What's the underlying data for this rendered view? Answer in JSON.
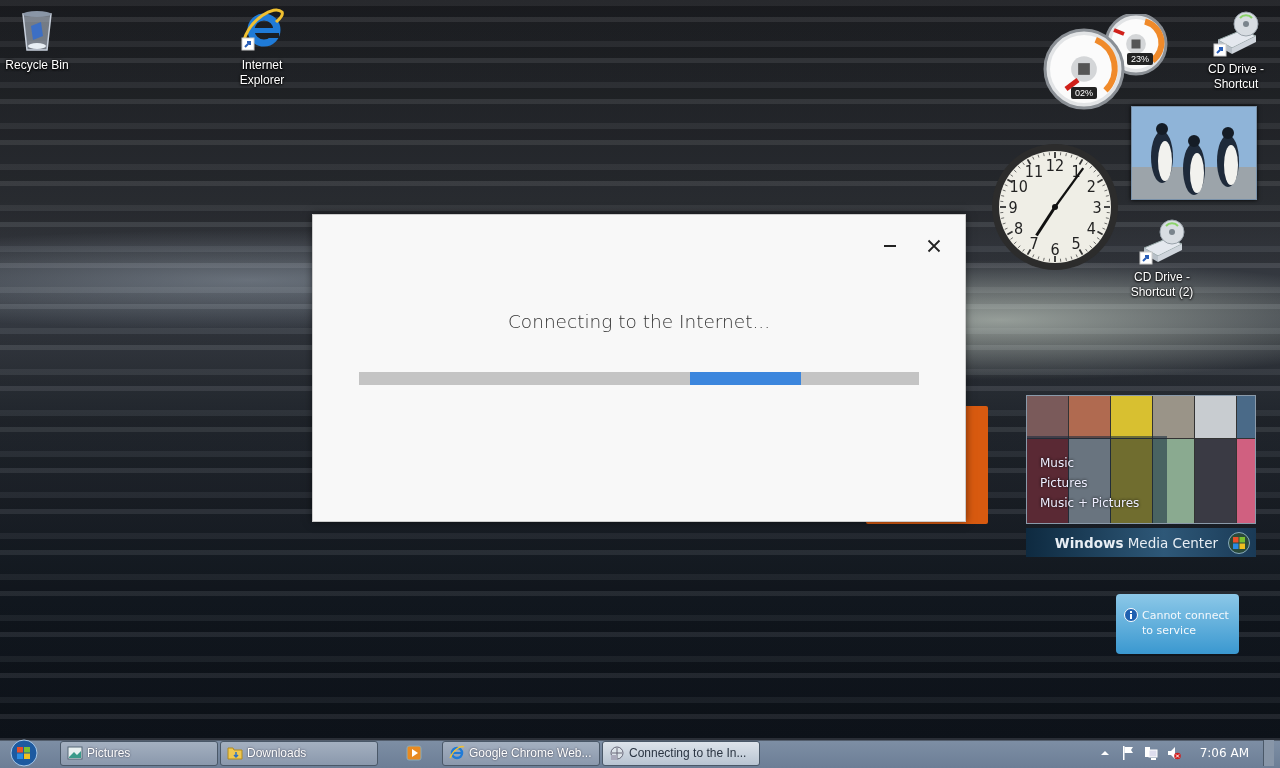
{
  "desktop_icons": [
    {
      "label": "Recycle Bin",
      "kind": "recycle"
    },
    {
      "label": "Internet Explorer",
      "kind": "ie"
    },
    {
      "label": "CD Drive - Shortcut",
      "kind": "cd"
    },
    {
      "label": "CD Drive - Shortcut (2)",
      "kind": "cd"
    }
  ],
  "gadgets": {
    "cpu_meter": {
      "readings": [
        "02%",
        "23%"
      ]
    },
    "clock": {
      "numerals": [
        "12",
        "11",
        "1",
        "10",
        "2",
        "9",
        "3",
        "8",
        "4",
        "7",
        "5",
        "6"
      ]
    },
    "media_center": {
      "menu": [
        "Music",
        "Pictures",
        "Music + Pictures"
      ],
      "brand": "**Windows** Media Center"
    },
    "feed": {
      "message": "Cannot connect to service"
    }
  },
  "dialog": {
    "message": "Connecting to the Internet..."
  },
  "taskbar": {
    "buttons": [
      {
        "label": "Pictures",
        "kind": "pictures",
        "selected": false
      },
      {
        "label": "Downloads",
        "kind": "folder",
        "selected": false
      },
      {
        "kind": "media",
        "selected": false
      },
      {
        "label": "Google Chrome Web...",
        "kind": "ie",
        "selected": false
      },
      {
        "label": "Connecting to the In...",
        "kind": "connect",
        "selected": true
      }
    ],
    "clock": "7:06 AM"
  }
}
